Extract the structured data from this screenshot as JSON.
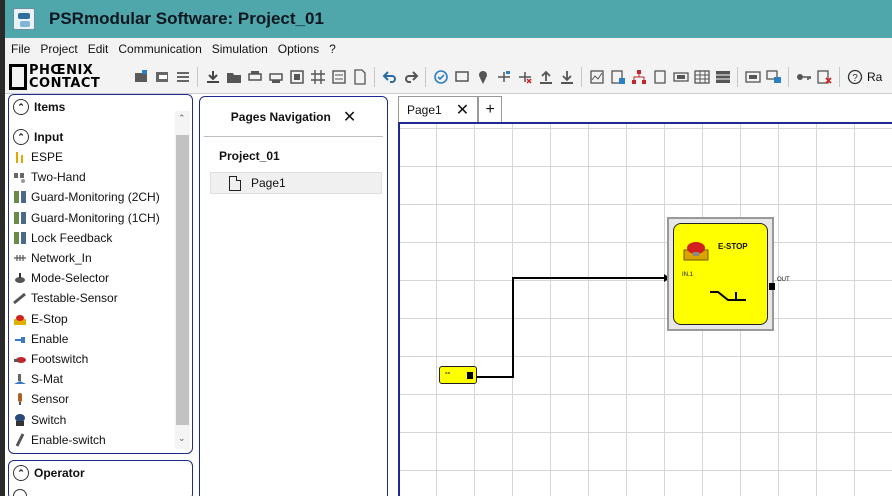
{
  "title": "PSRmodular Software: Project_01",
  "menu": [
    "File",
    "Project",
    "Edit",
    "Communication",
    "Simulation",
    "Options",
    "?"
  ],
  "logo": {
    "line1": "PHŒNIX",
    "line2": "CONTACT"
  },
  "toolbar": {
    "trailing_text": "Ra"
  },
  "items_panel": {
    "title": "Items",
    "group_input": "Input",
    "items": [
      {
        "label": "ESPE",
        "icon": "light-curtain-icon"
      },
      {
        "label": "Two-Hand",
        "icon": "two-hand-icon"
      },
      {
        "label": "Guard-Monitoring (2CH)",
        "icon": "guard-2ch-icon"
      },
      {
        "label": "Guard-Monitoring (1CH)",
        "icon": "guard-1ch-icon"
      },
      {
        "label": "Lock Feedback",
        "icon": "lock-feedback-icon"
      },
      {
        "label": "Network_In",
        "icon": "network-in-icon"
      },
      {
        "label": "Mode-Selector",
        "icon": "mode-selector-icon"
      },
      {
        "label": "Testable-Sensor",
        "icon": "testable-sensor-icon"
      },
      {
        "label": "E-Stop",
        "icon": "e-stop-icon"
      },
      {
        "label": "Enable",
        "icon": "enable-icon"
      },
      {
        "label": "Footswitch",
        "icon": "footswitch-icon"
      },
      {
        "label": "S-Mat",
        "icon": "s-mat-icon"
      },
      {
        "label": "Sensor",
        "icon": "sensor-icon"
      },
      {
        "label": "Switch",
        "icon": "switch-icon"
      },
      {
        "label": "Enable-switch",
        "icon": "enable-switch-icon"
      }
    ]
  },
  "operator_panel": {
    "title": "Operator"
  },
  "pages_navigation": {
    "title": "Pages Navigation",
    "project": "Project_01",
    "pages": [
      "Page1"
    ]
  },
  "tabs": {
    "active": "Page1",
    "add_label": "+"
  },
  "canvas": {
    "block_title": "E-STOP",
    "in_label": "IN.1",
    "out_label": "OUT",
    "source_label": "--"
  },
  "colors": {
    "titlebar": "#4fa7ac",
    "panel_border": "#1f2a8f",
    "block_fill": "#ffff00"
  }
}
